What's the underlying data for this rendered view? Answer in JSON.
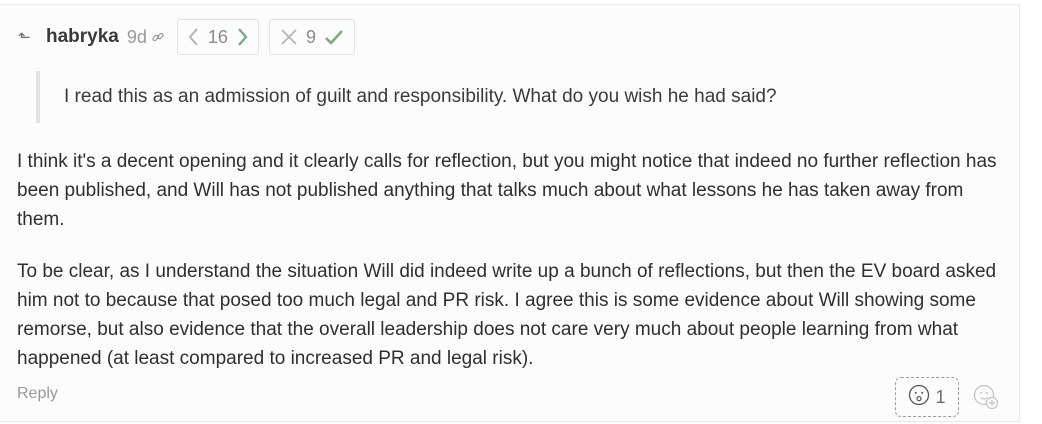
{
  "comment": {
    "author": "habryka",
    "age": "9d",
    "karma": {
      "score": "16"
    },
    "agreement": {
      "score": "9"
    },
    "quote": "I read this as an admission of guilt and responsibility. What do you wish he had said?",
    "paragraphs": [
      "I think it's a decent opening and it clearly calls for reflection, but you might notice that indeed no further reflection has been published, and Will has not published anything that talks much about what lessons he has taken away from them.",
      "To be clear, as I understand the situation Will did indeed write up a bunch of reflections, but then the EV board asked him not to because that posed too much legal and PR risk. I agree this is some evidence about Will showing some remorse, but also evidence that the overall leadership does not care very much about people learning from what happened (at least compared to increased PR and legal risk)."
    ],
    "reply_label": "Reply",
    "reactions": {
      "count": "1"
    }
  },
  "icons": {
    "parent": "parent-comment-icon",
    "link": "link-icon",
    "downvote": "chevron-left-icon",
    "upvote": "chevron-right-icon",
    "disagree": "x-icon",
    "agree": "checkmark-icon",
    "reaction": "surprised-face-icon",
    "add_reaction": "add-reaction-icon"
  },
  "colors": {
    "vote_active": "#7faa7f",
    "muted": "#9a9a9a",
    "text": "#2f2f2f"
  }
}
